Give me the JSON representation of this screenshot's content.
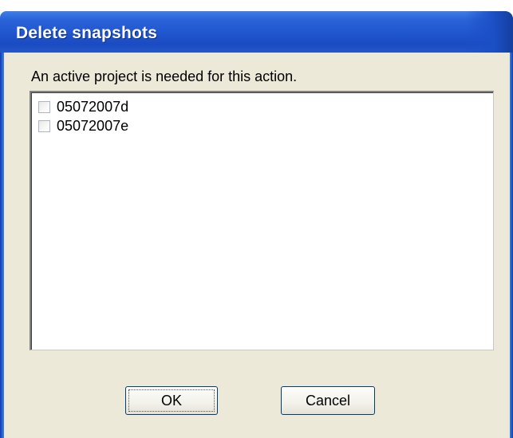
{
  "dialog": {
    "title": "Delete snapshots",
    "message": "An active project is needed for this action.",
    "snapshots": [
      {
        "label": "05072007d",
        "checked": false
      },
      {
        "label": "05072007e",
        "checked": false
      }
    ],
    "ok_label": "OK",
    "cancel_label": "Cancel"
  },
  "colors": {
    "titlebar": "#2b63d8",
    "client_background": "#ece9d8",
    "button_border": "#003c74"
  }
}
